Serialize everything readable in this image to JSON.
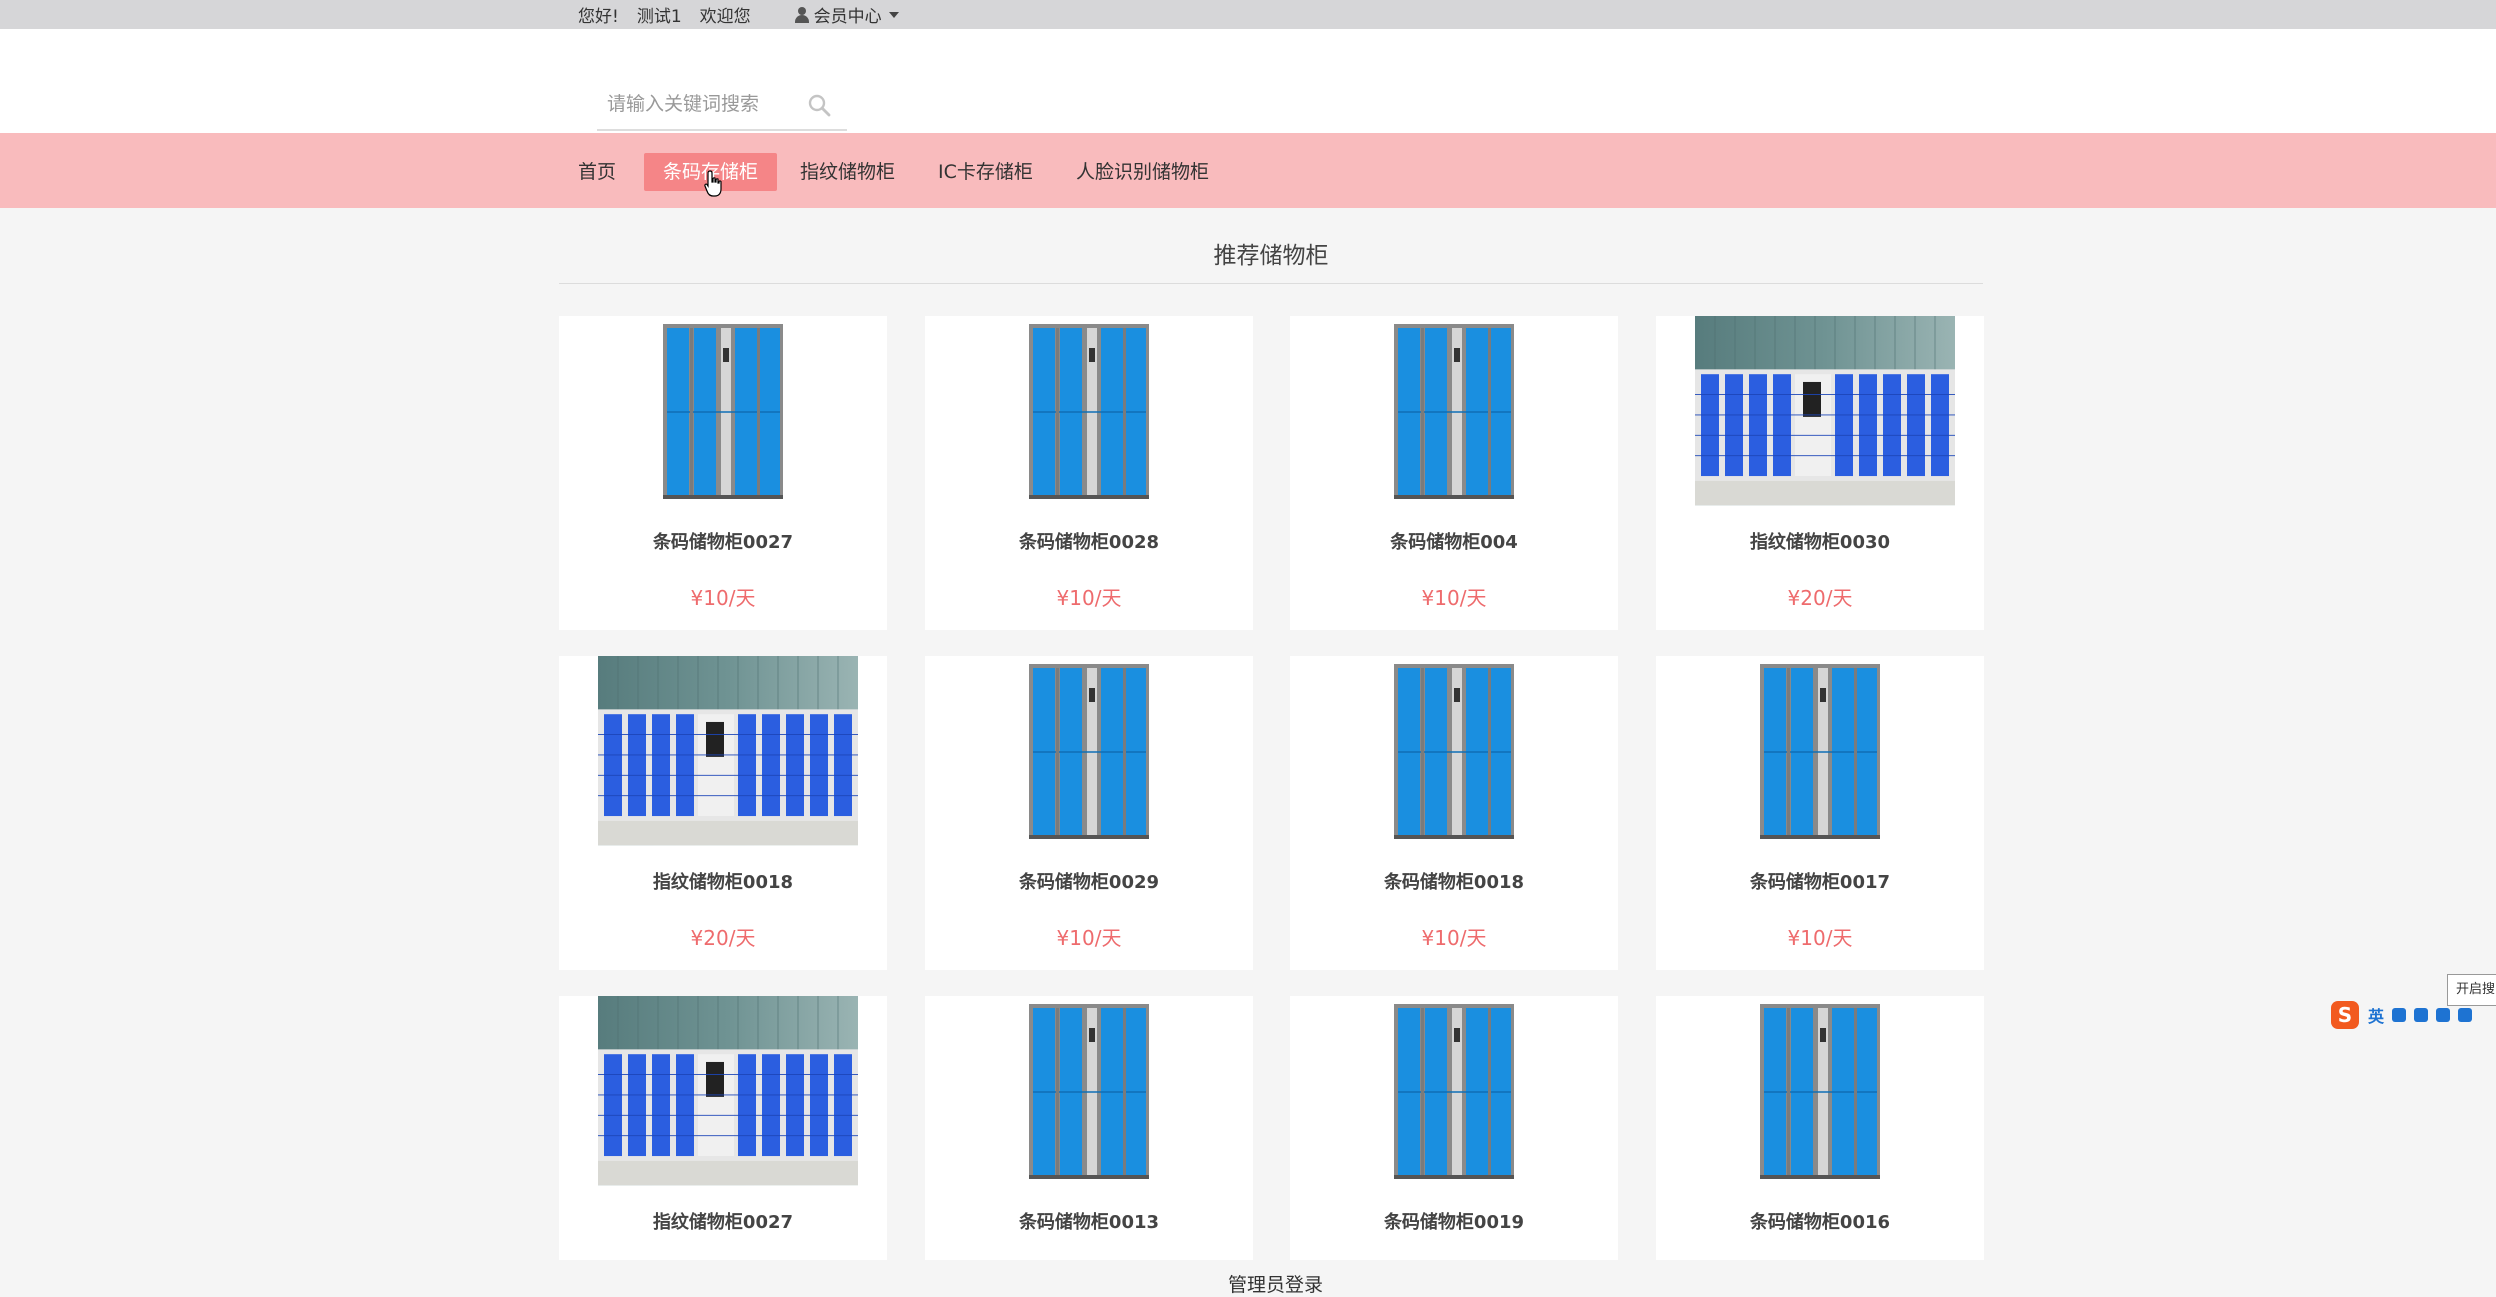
{
  "topbar": {
    "greeting": "您好!",
    "username": "测试1",
    "welcome": "欢迎您",
    "member_center": "会员中心"
  },
  "search": {
    "placeholder": "请输入关键词搜索"
  },
  "nav": {
    "items": [
      "首页",
      "条码存储柜",
      "指纹储物柜",
      "IC卡存储柜",
      "人脸识别储物柜"
    ],
    "active_index": 1
  },
  "section": {
    "title": "推荐储物柜"
  },
  "products": [
    {
      "name": "条码储物柜0027",
      "price": "¥10/天",
      "image": "barcode-locker"
    },
    {
      "name": "条码储物柜0028",
      "price": "¥10/天",
      "image": "barcode-locker"
    },
    {
      "name": "条码储物柜004",
      "price": "¥10/天",
      "image": "barcode-locker"
    },
    {
      "name": "指纹储物柜0030",
      "price": "¥20/天",
      "image": "fingerprint-locker-wall"
    },
    {
      "name": "指纹储物柜0018",
      "price": "¥20/天",
      "image": "fingerprint-locker-wall"
    },
    {
      "name": "条码储物柜0029",
      "price": "¥10/天",
      "image": "barcode-locker"
    },
    {
      "name": "条码储物柜0018",
      "price": "¥10/天",
      "image": "barcode-locker"
    },
    {
      "name": "条码储物柜0017",
      "price": "¥10/天",
      "image": "barcode-locker"
    },
    {
      "name": "指纹储物柜0027",
      "price": "",
      "image": "fingerprint-locker-wall"
    },
    {
      "name": "条码储物柜0013",
      "price": "",
      "image": "barcode-locker"
    },
    {
      "name": "条码储物柜0019",
      "price": "",
      "image": "barcode-locker"
    },
    {
      "name": "条码储物柜0016",
      "price": "",
      "image": "barcode-locker"
    }
  ],
  "footer": {
    "admin_login": "管理员登录"
  },
  "ime": {
    "tip": "开启搜",
    "mode": "英"
  },
  "colors": {
    "nav_bg": "#f9bbbd",
    "nav_active": "#f58587",
    "price": "#ee6b6d",
    "locker_blue": "#1a8fe0"
  }
}
